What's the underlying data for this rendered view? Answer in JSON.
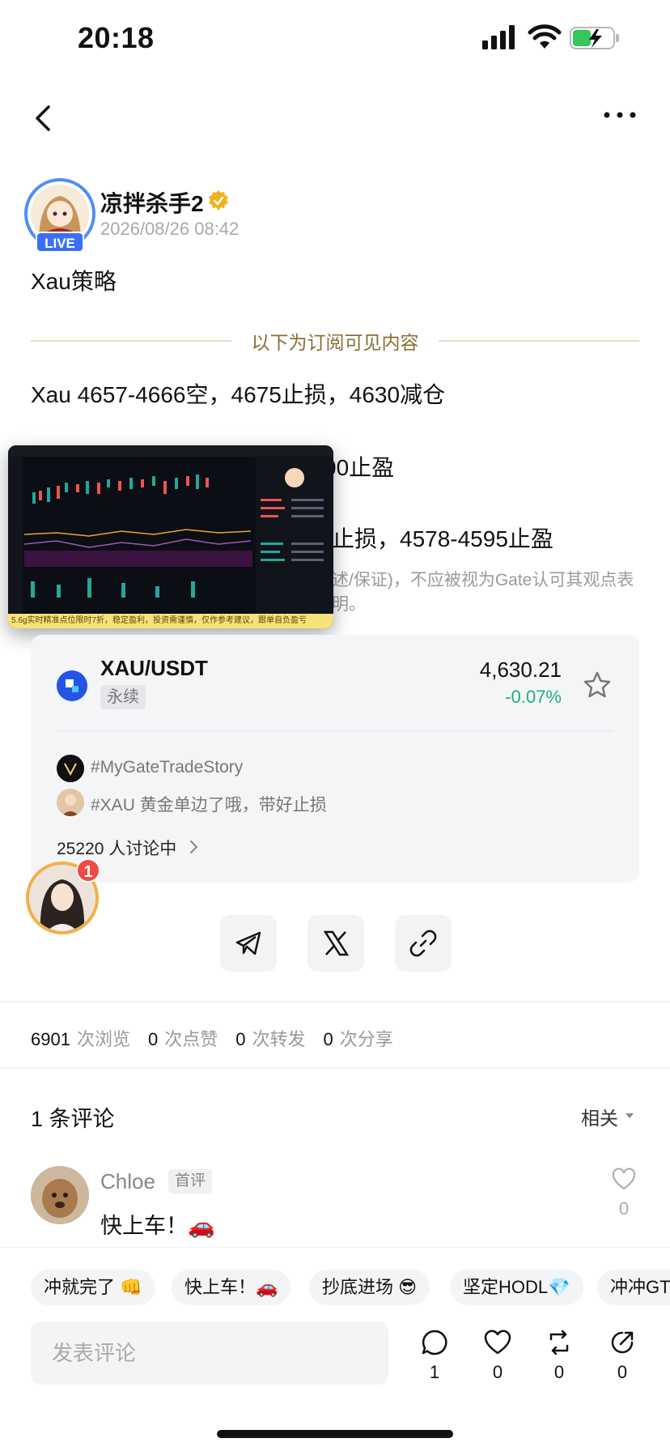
{
  "status_bar": {
    "time": "20:18"
  },
  "author": {
    "name": "凉拌杀手2",
    "timestamp": "2026/08/26 08:42",
    "live_label": "LIVE"
  },
  "post": {
    "title": "Xau策略",
    "divider_label": "以下为订阅可见内容",
    "line1": "Xau 4657-4666空，4675止损，4630减仓",
    "line2": "00止盈",
    "line3": "止损，4578-4595止盈",
    "disclaimer": "述/保证)，不应被视为Gate认可其观点表\n明。"
  },
  "screenshot": {
    "banner": "5.6g实时精准点位限时7折，稳定盈利，投资需谨慎，仅作参考建议，跟单自负盈亏"
  },
  "trade_card": {
    "pair": "XAU/USDT",
    "type": "永续",
    "price": "4,630.21",
    "change": "-0.07%",
    "tag1": "#MyGateTradeStory",
    "tag2": "#XAU 黄金单边了哦，带好止损",
    "discussing": "25220 人讨论中"
  },
  "bubble": {
    "badge": "1"
  },
  "stats": {
    "views": "6901",
    "views_label": "次浏览",
    "likes": "0",
    "likes_label": "次点赞",
    "reposts": "0",
    "reposts_label": "次转发",
    "shares": "0",
    "shares_label": "次分享"
  },
  "comments": {
    "header": "1 条评论",
    "sort": "相关",
    "items": [
      {
        "name": "Chloe",
        "tag": "首评",
        "text": "快上车！🚗",
        "likes": "0"
      }
    ]
  },
  "quick_replies": [
    "冲就完了 👊",
    "快上车！🚗",
    "抄底进场 😎",
    "坚定HODL💎",
    "冲冲GT"
  ],
  "bottom": {
    "input_placeholder": "发表评论",
    "comment_count": "1",
    "like_count": "0",
    "repost_count": "0",
    "share_count": "0"
  },
  "colors": {
    "accent_blue": "#3a6ff7",
    "positive_green": "#1bb273",
    "divider_gold": "#8c6d33",
    "badge_red": "#ef4a43"
  }
}
